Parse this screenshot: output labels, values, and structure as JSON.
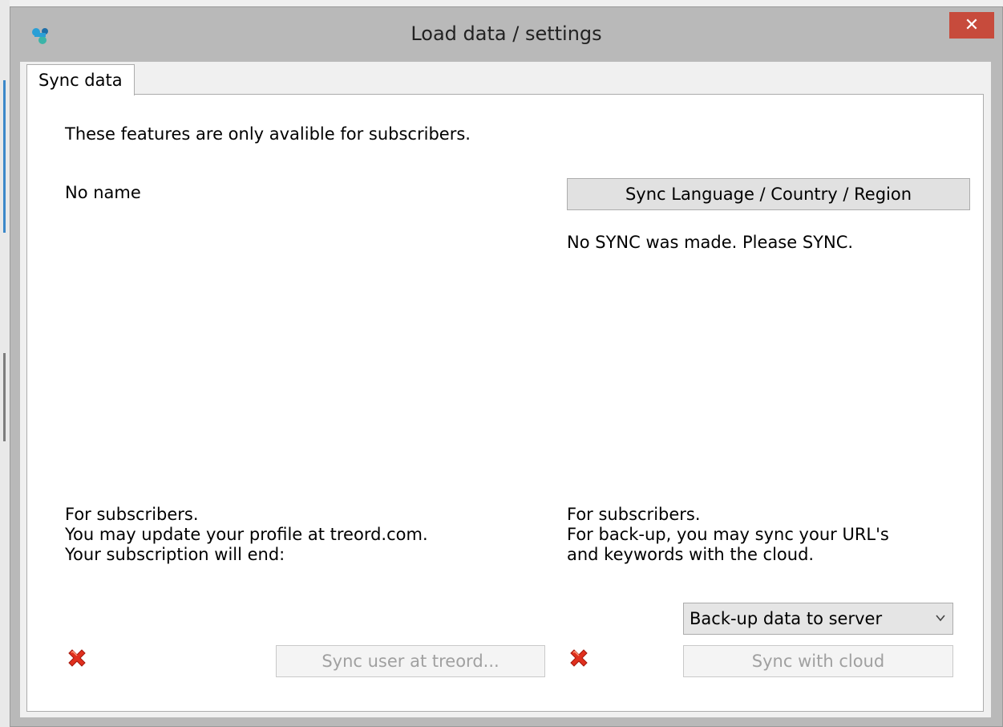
{
  "window": {
    "title": "Load data / settings",
    "close_glyph": "✕"
  },
  "tabs": [
    {
      "label": "Sync data",
      "selected": true
    }
  ],
  "panel": {
    "notice": "These features are only avalible for subscribers.",
    "user_name": "No name",
    "sync_language_button": "Sync Language / Country / Region",
    "sync_status": "No SYNC was made. Please SYNC.",
    "left_info": {
      "line1": "For subscribers.",
      "line2": "You may update your profile at treord.com.",
      "line3": "Your subscription will end:"
    },
    "right_info": {
      "line1": "For subscribers.",
      "line2": "For back-up, you may sync your URL's",
      "line3": "and keywords with the cloud."
    },
    "backup_select": {
      "value": "Back-up data to server"
    },
    "sync_user_button": "Sync user at treord...",
    "sync_cloud_button": "Sync with cloud",
    "status_icon_left": "red-x-icon",
    "status_icon_right": "red-x-icon"
  },
  "colors": {
    "close_button": "#c74b3c",
    "status_error": "#e0301e",
    "accent_icon": "#2a9fd6"
  }
}
